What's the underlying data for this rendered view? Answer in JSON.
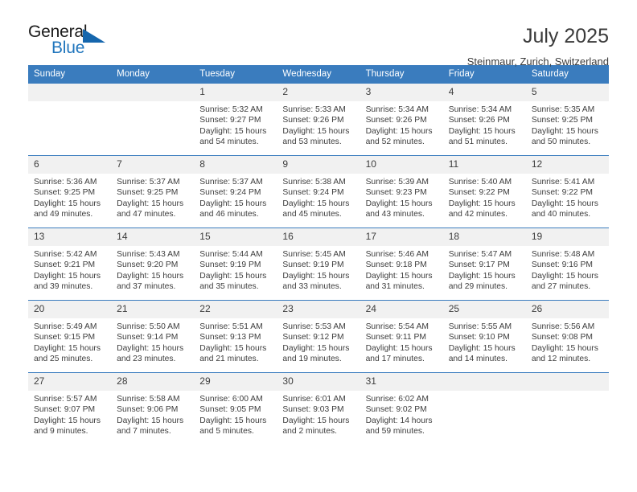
{
  "brand": {
    "word_one": "General",
    "word_two": "Blue",
    "triangle_icon": "triangle-icon"
  },
  "header": {
    "title": "July 2025",
    "subtitle": "Steinmaur, Zurich, Switzerland"
  },
  "colors": {
    "header_blue": "#3a7cbe",
    "brand_blue": "#2176bd",
    "daynum_bg": "#f1f1f1",
    "text": "#3d3d3d"
  },
  "calendar": {
    "weekday_headers": [
      "Sunday",
      "Monday",
      "Tuesday",
      "Wednesday",
      "Thursday",
      "Friday",
      "Saturday"
    ],
    "weeks": [
      [
        {
          "day": "",
          "lines": []
        },
        {
          "day": "",
          "lines": []
        },
        {
          "day": "1",
          "lines": [
            "Sunrise: 5:32 AM",
            "Sunset: 9:27 PM",
            "Daylight: 15 hours",
            "and 54 minutes."
          ]
        },
        {
          "day": "2",
          "lines": [
            "Sunrise: 5:33 AM",
            "Sunset: 9:26 PM",
            "Daylight: 15 hours",
            "and 53 minutes."
          ]
        },
        {
          "day": "3",
          "lines": [
            "Sunrise: 5:34 AM",
            "Sunset: 9:26 PM",
            "Daylight: 15 hours",
            "and 52 minutes."
          ]
        },
        {
          "day": "4",
          "lines": [
            "Sunrise: 5:34 AM",
            "Sunset: 9:26 PM",
            "Daylight: 15 hours",
            "and 51 minutes."
          ]
        },
        {
          "day": "5",
          "lines": [
            "Sunrise: 5:35 AM",
            "Sunset: 9:25 PM",
            "Daylight: 15 hours",
            "and 50 minutes."
          ]
        }
      ],
      [
        {
          "day": "6",
          "lines": [
            "Sunrise: 5:36 AM",
            "Sunset: 9:25 PM",
            "Daylight: 15 hours",
            "and 49 minutes."
          ]
        },
        {
          "day": "7",
          "lines": [
            "Sunrise: 5:37 AM",
            "Sunset: 9:25 PM",
            "Daylight: 15 hours",
            "and 47 minutes."
          ]
        },
        {
          "day": "8",
          "lines": [
            "Sunrise: 5:37 AM",
            "Sunset: 9:24 PM",
            "Daylight: 15 hours",
            "and 46 minutes."
          ]
        },
        {
          "day": "9",
          "lines": [
            "Sunrise: 5:38 AM",
            "Sunset: 9:24 PM",
            "Daylight: 15 hours",
            "and 45 minutes."
          ]
        },
        {
          "day": "10",
          "lines": [
            "Sunrise: 5:39 AM",
            "Sunset: 9:23 PM",
            "Daylight: 15 hours",
            "and 43 minutes."
          ]
        },
        {
          "day": "11",
          "lines": [
            "Sunrise: 5:40 AM",
            "Sunset: 9:22 PM",
            "Daylight: 15 hours",
            "and 42 minutes."
          ]
        },
        {
          "day": "12",
          "lines": [
            "Sunrise: 5:41 AM",
            "Sunset: 9:22 PM",
            "Daylight: 15 hours",
            "and 40 minutes."
          ]
        }
      ],
      [
        {
          "day": "13",
          "lines": [
            "Sunrise: 5:42 AM",
            "Sunset: 9:21 PM",
            "Daylight: 15 hours",
            "and 39 minutes."
          ]
        },
        {
          "day": "14",
          "lines": [
            "Sunrise: 5:43 AM",
            "Sunset: 9:20 PM",
            "Daylight: 15 hours",
            "and 37 minutes."
          ]
        },
        {
          "day": "15",
          "lines": [
            "Sunrise: 5:44 AM",
            "Sunset: 9:19 PM",
            "Daylight: 15 hours",
            "and 35 minutes."
          ]
        },
        {
          "day": "16",
          "lines": [
            "Sunrise: 5:45 AM",
            "Sunset: 9:19 PM",
            "Daylight: 15 hours",
            "and 33 minutes."
          ]
        },
        {
          "day": "17",
          "lines": [
            "Sunrise: 5:46 AM",
            "Sunset: 9:18 PM",
            "Daylight: 15 hours",
            "and 31 minutes."
          ]
        },
        {
          "day": "18",
          "lines": [
            "Sunrise: 5:47 AM",
            "Sunset: 9:17 PM",
            "Daylight: 15 hours",
            "and 29 minutes."
          ]
        },
        {
          "day": "19",
          "lines": [
            "Sunrise: 5:48 AM",
            "Sunset: 9:16 PM",
            "Daylight: 15 hours",
            "and 27 minutes."
          ]
        }
      ],
      [
        {
          "day": "20",
          "lines": [
            "Sunrise: 5:49 AM",
            "Sunset: 9:15 PM",
            "Daylight: 15 hours",
            "and 25 minutes."
          ]
        },
        {
          "day": "21",
          "lines": [
            "Sunrise: 5:50 AM",
            "Sunset: 9:14 PM",
            "Daylight: 15 hours",
            "and 23 minutes."
          ]
        },
        {
          "day": "22",
          "lines": [
            "Sunrise: 5:51 AM",
            "Sunset: 9:13 PM",
            "Daylight: 15 hours",
            "and 21 minutes."
          ]
        },
        {
          "day": "23",
          "lines": [
            "Sunrise: 5:53 AM",
            "Sunset: 9:12 PM",
            "Daylight: 15 hours",
            "and 19 minutes."
          ]
        },
        {
          "day": "24",
          "lines": [
            "Sunrise: 5:54 AM",
            "Sunset: 9:11 PM",
            "Daylight: 15 hours",
            "and 17 minutes."
          ]
        },
        {
          "day": "25",
          "lines": [
            "Sunrise: 5:55 AM",
            "Sunset: 9:10 PM",
            "Daylight: 15 hours",
            "and 14 minutes."
          ]
        },
        {
          "day": "26",
          "lines": [
            "Sunrise: 5:56 AM",
            "Sunset: 9:08 PM",
            "Daylight: 15 hours",
            "and 12 minutes."
          ]
        }
      ],
      [
        {
          "day": "27",
          "lines": [
            "Sunrise: 5:57 AM",
            "Sunset: 9:07 PM",
            "Daylight: 15 hours",
            "and 9 minutes."
          ]
        },
        {
          "day": "28",
          "lines": [
            "Sunrise: 5:58 AM",
            "Sunset: 9:06 PM",
            "Daylight: 15 hours",
            "and 7 minutes."
          ]
        },
        {
          "day": "29",
          "lines": [
            "Sunrise: 6:00 AM",
            "Sunset: 9:05 PM",
            "Daylight: 15 hours",
            "and 5 minutes."
          ]
        },
        {
          "day": "30",
          "lines": [
            "Sunrise: 6:01 AM",
            "Sunset: 9:03 PM",
            "Daylight: 15 hours",
            "and 2 minutes."
          ]
        },
        {
          "day": "31",
          "lines": [
            "Sunrise: 6:02 AM",
            "Sunset: 9:02 PM",
            "Daylight: 14 hours",
            "and 59 minutes."
          ]
        },
        {
          "day": "",
          "lines": []
        },
        {
          "day": "",
          "lines": []
        }
      ]
    ]
  }
}
